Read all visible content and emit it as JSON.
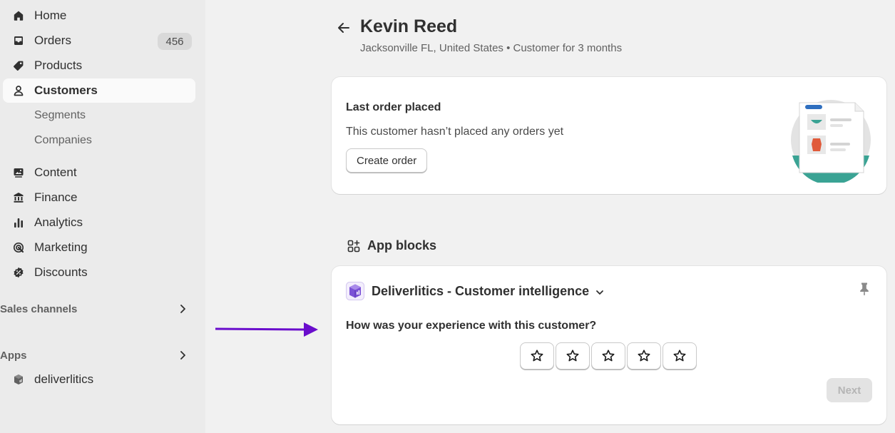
{
  "sidebar": {
    "items": [
      {
        "label": "Home",
        "icon": "home-icon"
      },
      {
        "label": "Orders",
        "icon": "inbox-icon",
        "badge": "456"
      },
      {
        "label": "Products",
        "icon": "tag-icon"
      },
      {
        "label": "Customers",
        "icon": "person-icon",
        "active": true
      },
      {
        "label": "Segments"
      },
      {
        "label": "Companies"
      },
      {
        "label": "Content",
        "icon": "image-icon"
      },
      {
        "label": "Finance",
        "icon": "bank-icon"
      },
      {
        "label": "Analytics",
        "icon": "bar-chart-icon"
      },
      {
        "label": "Marketing",
        "icon": "target-icon"
      },
      {
        "label": "Discounts",
        "icon": "discount-icon"
      }
    ],
    "sales_channels": "Sales channels",
    "apps": "Apps",
    "app_items": [
      {
        "label": "deliverlitics",
        "icon": "deliverlitics-icon"
      }
    ]
  },
  "customer": {
    "name": "Kevin Reed",
    "subtitle": "Jacksonville FL, United States • Customer for 3 months"
  },
  "last_order": {
    "title": "Last order placed",
    "text": "This customer hasn’t placed any orders yet",
    "button": "Create order"
  },
  "app_blocks": {
    "title": "App blocks",
    "app_name": "Deliverlitics - Customer intelligence",
    "question": "How was your experience with this customer?",
    "rating_max": 5,
    "next_button": "Next"
  },
  "colors": {
    "accent_arrow": "#6a0dcc",
    "teal": "#3aa394",
    "sidebar_bg": "#ebebeb",
    "page_bg": "#f1f1f1"
  }
}
